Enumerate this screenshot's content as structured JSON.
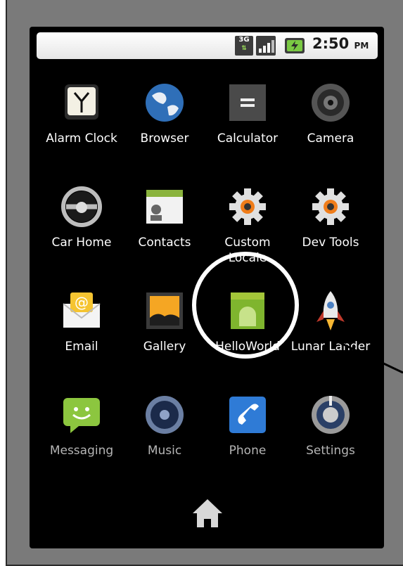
{
  "status_bar": {
    "network_label": "3G",
    "time": "2:50",
    "ampm": "PM",
    "icons": [
      "3g-icon",
      "signal-icon",
      "battery-icon"
    ]
  },
  "apps": [
    {
      "label": "Alarm Clock",
      "icon": "alarm-clock-icon"
    },
    {
      "label": "Browser",
      "icon": "globe-icon"
    },
    {
      "label": "Calculator",
      "icon": "calculator-icon"
    },
    {
      "label": "Camera",
      "icon": "camera-icon"
    },
    {
      "label": "Car Home",
      "icon": "steering-wheel-icon"
    },
    {
      "label": "Contacts",
      "icon": "contacts-icon"
    },
    {
      "label": "Custom Locale",
      "icon": "gear-icon"
    },
    {
      "label": "Dev Tools",
      "icon": "gear-icon"
    },
    {
      "label": "Email",
      "icon": "envelope-icon"
    },
    {
      "label": "Gallery",
      "icon": "gallery-icon"
    },
    {
      "label": "HelloWorld",
      "icon": "android-icon"
    },
    {
      "label": "Lunar Lander",
      "icon": "rocket-icon"
    },
    {
      "label": "Messaging",
      "icon": "speech-bubble-icon"
    },
    {
      "label": "Music",
      "icon": "speaker-icon"
    },
    {
      "label": "Phone",
      "icon": "phone-icon"
    },
    {
      "label": "Settings",
      "icon": "settings-icon"
    }
  ],
  "home_button": {
    "icon": "home-icon"
  },
  "colors": {
    "screen": "#000000",
    "frame": "#7a7a7a",
    "highlight": "#ffffff",
    "android_green": "#a4c639"
  }
}
